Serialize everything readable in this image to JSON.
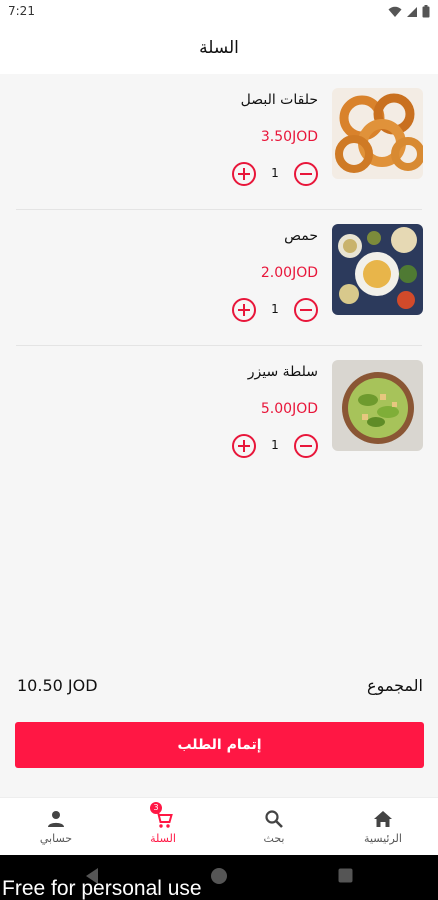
{
  "status_bar": {
    "time": "7:21"
  },
  "header": {
    "title": "السلة"
  },
  "cart": {
    "items": [
      {
        "name": "حلقات البصل",
        "price": "3.50JOD",
        "quantity": "1",
        "image": "onion-rings-image"
      },
      {
        "name": "حمص",
        "price": "2.00JOD",
        "quantity": "1",
        "image": "hummus-image"
      },
      {
        "name": "سلطة سيزر",
        "price": "5.00JOD",
        "quantity": "1",
        "image": "caesar-salad-image"
      }
    ]
  },
  "summary": {
    "total_label": "المجموع",
    "total_value": "10.50 JOD"
  },
  "checkout": {
    "label": "إتمام الطلب"
  },
  "bottom_nav": {
    "items": [
      {
        "label": "الرئيسية",
        "icon": "home-icon"
      },
      {
        "label": "بحث",
        "icon": "search-icon"
      },
      {
        "label": "السلة",
        "icon": "cart-icon",
        "badge": "3",
        "active": true
      },
      {
        "label": "حسابي",
        "icon": "person-icon"
      }
    ]
  },
  "watermark": {
    "text": "Free for personal use"
  },
  "colors": {
    "accent": "#ff1744",
    "price": "#e8163a",
    "background": "#f6f6f6"
  }
}
